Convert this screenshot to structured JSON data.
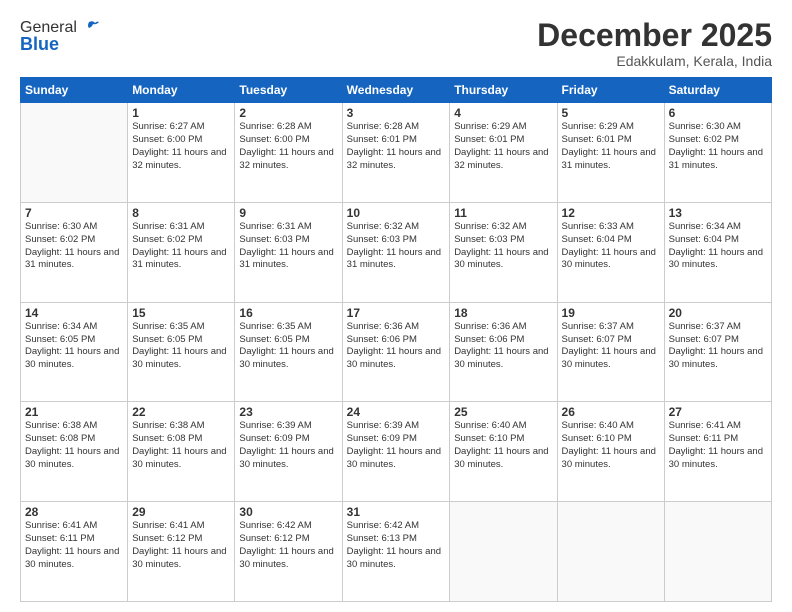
{
  "header": {
    "logo": {
      "general": "General",
      "blue": "Blue"
    },
    "title": "December 2025",
    "location": "Edakkulam, Kerala, India"
  },
  "calendar": {
    "weekdays": [
      "Sunday",
      "Monday",
      "Tuesday",
      "Wednesday",
      "Thursday",
      "Friday",
      "Saturday"
    ],
    "weeks": [
      [
        {
          "day": "",
          "empty": true
        },
        {
          "day": "1",
          "sunrise": "Sunrise: 6:27 AM",
          "sunset": "Sunset: 6:00 PM",
          "daylight": "Daylight: 11 hours and 32 minutes."
        },
        {
          "day": "2",
          "sunrise": "Sunrise: 6:28 AM",
          "sunset": "Sunset: 6:00 PM",
          "daylight": "Daylight: 11 hours and 32 minutes."
        },
        {
          "day": "3",
          "sunrise": "Sunrise: 6:28 AM",
          "sunset": "Sunset: 6:01 PM",
          "daylight": "Daylight: 11 hours and 32 minutes."
        },
        {
          "day": "4",
          "sunrise": "Sunrise: 6:29 AM",
          "sunset": "Sunset: 6:01 PM",
          "daylight": "Daylight: 11 hours and 32 minutes."
        },
        {
          "day": "5",
          "sunrise": "Sunrise: 6:29 AM",
          "sunset": "Sunset: 6:01 PM",
          "daylight": "Daylight: 11 hours and 31 minutes."
        },
        {
          "day": "6",
          "sunrise": "Sunrise: 6:30 AM",
          "sunset": "Sunset: 6:02 PM",
          "daylight": "Daylight: 11 hours and 31 minutes."
        }
      ],
      [
        {
          "day": "7",
          "sunrise": "Sunrise: 6:30 AM",
          "sunset": "Sunset: 6:02 PM",
          "daylight": "Daylight: 11 hours and 31 minutes."
        },
        {
          "day": "8",
          "sunrise": "Sunrise: 6:31 AM",
          "sunset": "Sunset: 6:02 PM",
          "daylight": "Daylight: 11 hours and 31 minutes."
        },
        {
          "day": "9",
          "sunrise": "Sunrise: 6:31 AM",
          "sunset": "Sunset: 6:03 PM",
          "daylight": "Daylight: 11 hours and 31 minutes."
        },
        {
          "day": "10",
          "sunrise": "Sunrise: 6:32 AM",
          "sunset": "Sunset: 6:03 PM",
          "daylight": "Daylight: 11 hours and 31 minutes."
        },
        {
          "day": "11",
          "sunrise": "Sunrise: 6:32 AM",
          "sunset": "Sunset: 6:03 PM",
          "daylight": "Daylight: 11 hours and 30 minutes."
        },
        {
          "day": "12",
          "sunrise": "Sunrise: 6:33 AM",
          "sunset": "Sunset: 6:04 PM",
          "daylight": "Daylight: 11 hours and 30 minutes."
        },
        {
          "day": "13",
          "sunrise": "Sunrise: 6:34 AM",
          "sunset": "Sunset: 6:04 PM",
          "daylight": "Daylight: 11 hours and 30 minutes."
        }
      ],
      [
        {
          "day": "14",
          "sunrise": "Sunrise: 6:34 AM",
          "sunset": "Sunset: 6:05 PM",
          "daylight": "Daylight: 11 hours and 30 minutes."
        },
        {
          "day": "15",
          "sunrise": "Sunrise: 6:35 AM",
          "sunset": "Sunset: 6:05 PM",
          "daylight": "Daylight: 11 hours and 30 minutes."
        },
        {
          "day": "16",
          "sunrise": "Sunrise: 6:35 AM",
          "sunset": "Sunset: 6:05 PM",
          "daylight": "Daylight: 11 hours and 30 minutes."
        },
        {
          "day": "17",
          "sunrise": "Sunrise: 6:36 AM",
          "sunset": "Sunset: 6:06 PM",
          "daylight": "Daylight: 11 hours and 30 minutes."
        },
        {
          "day": "18",
          "sunrise": "Sunrise: 6:36 AM",
          "sunset": "Sunset: 6:06 PM",
          "daylight": "Daylight: 11 hours and 30 minutes."
        },
        {
          "day": "19",
          "sunrise": "Sunrise: 6:37 AM",
          "sunset": "Sunset: 6:07 PM",
          "daylight": "Daylight: 11 hours and 30 minutes."
        },
        {
          "day": "20",
          "sunrise": "Sunrise: 6:37 AM",
          "sunset": "Sunset: 6:07 PM",
          "daylight": "Daylight: 11 hours and 30 minutes."
        }
      ],
      [
        {
          "day": "21",
          "sunrise": "Sunrise: 6:38 AM",
          "sunset": "Sunset: 6:08 PM",
          "daylight": "Daylight: 11 hours and 30 minutes."
        },
        {
          "day": "22",
          "sunrise": "Sunrise: 6:38 AM",
          "sunset": "Sunset: 6:08 PM",
          "daylight": "Daylight: 11 hours and 30 minutes."
        },
        {
          "day": "23",
          "sunrise": "Sunrise: 6:39 AM",
          "sunset": "Sunset: 6:09 PM",
          "daylight": "Daylight: 11 hours and 30 minutes."
        },
        {
          "day": "24",
          "sunrise": "Sunrise: 6:39 AM",
          "sunset": "Sunset: 6:09 PM",
          "daylight": "Daylight: 11 hours and 30 minutes."
        },
        {
          "day": "25",
          "sunrise": "Sunrise: 6:40 AM",
          "sunset": "Sunset: 6:10 PM",
          "daylight": "Daylight: 11 hours and 30 minutes."
        },
        {
          "day": "26",
          "sunrise": "Sunrise: 6:40 AM",
          "sunset": "Sunset: 6:10 PM",
          "daylight": "Daylight: 11 hours and 30 minutes."
        },
        {
          "day": "27",
          "sunrise": "Sunrise: 6:41 AM",
          "sunset": "Sunset: 6:11 PM",
          "daylight": "Daylight: 11 hours and 30 minutes."
        }
      ],
      [
        {
          "day": "28",
          "sunrise": "Sunrise: 6:41 AM",
          "sunset": "Sunset: 6:11 PM",
          "daylight": "Daylight: 11 hours and 30 minutes."
        },
        {
          "day": "29",
          "sunrise": "Sunrise: 6:41 AM",
          "sunset": "Sunset: 6:12 PM",
          "daylight": "Daylight: 11 hours and 30 minutes."
        },
        {
          "day": "30",
          "sunrise": "Sunrise: 6:42 AM",
          "sunset": "Sunset: 6:12 PM",
          "daylight": "Daylight: 11 hours and 30 minutes."
        },
        {
          "day": "31",
          "sunrise": "Sunrise: 6:42 AM",
          "sunset": "Sunset: 6:13 PM",
          "daylight": "Daylight: 11 hours and 30 minutes."
        },
        {
          "day": "",
          "empty": true
        },
        {
          "day": "",
          "empty": true
        },
        {
          "day": "",
          "empty": true
        }
      ]
    ]
  }
}
